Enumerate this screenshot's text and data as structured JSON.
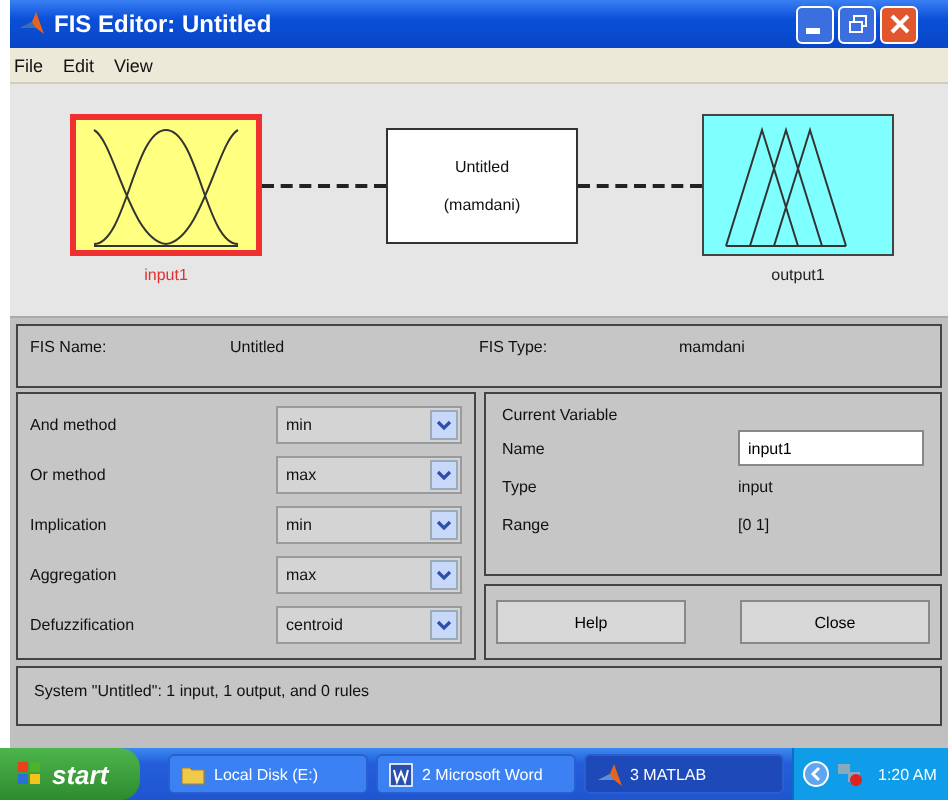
{
  "window": {
    "title": "FIS Editor: Untitled"
  },
  "menu": [
    "File",
    "Edit",
    "View"
  ],
  "diagram": {
    "variables": [
      {
        "kind": "input",
        "label": "input1",
        "selected": true
      },
      {
        "kind": "output",
        "label": "output1",
        "selected": false
      }
    ],
    "system": {
      "name": "Untitled",
      "type": "(mamdani)"
    }
  },
  "fis_info": [
    {
      "label": "FIS Name:",
      "value": "Untitled"
    },
    {
      "label": "FIS Type:",
      "value": "mamdani"
    }
  ],
  "methods": [
    {
      "label": "And method",
      "value": "min"
    },
    {
      "label": "Or method",
      "value": "max"
    },
    {
      "label": "Implication",
      "value": "min"
    },
    {
      "label": "Aggregation",
      "value": "max"
    },
    {
      "label": "Defuzzification",
      "value": "centroid"
    }
  ],
  "current_variable": {
    "heading": "Current Variable",
    "fields": [
      {
        "kind": "input",
        "label": "Name",
        "value": "input1"
      },
      {
        "kind": "text",
        "label": "Type",
        "value": "input"
      },
      {
        "kind": "text",
        "label": "Range",
        "value": "[0 1]"
      }
    ]
  },
  "buttons": [
    "Help",
    "Close"
  ],
  "status": "System \"Untitled\": 1 input, 1 output, and 0 rules",
  "taskbar": {
    "start": "start",
    "items": [
      {
        "label": "Local Disk (E:)",
        "kind": "folder",
        "selected": false
      },
      {
        "label": "2 Microsoft Word",
        "kind": "word",
        "selected": false
      },
      {
        "label": "3 MATLAB",
        "kind": "matlab",
        "selected": true
      }
    ],
    "time": "1:20 AM"
  }
}
